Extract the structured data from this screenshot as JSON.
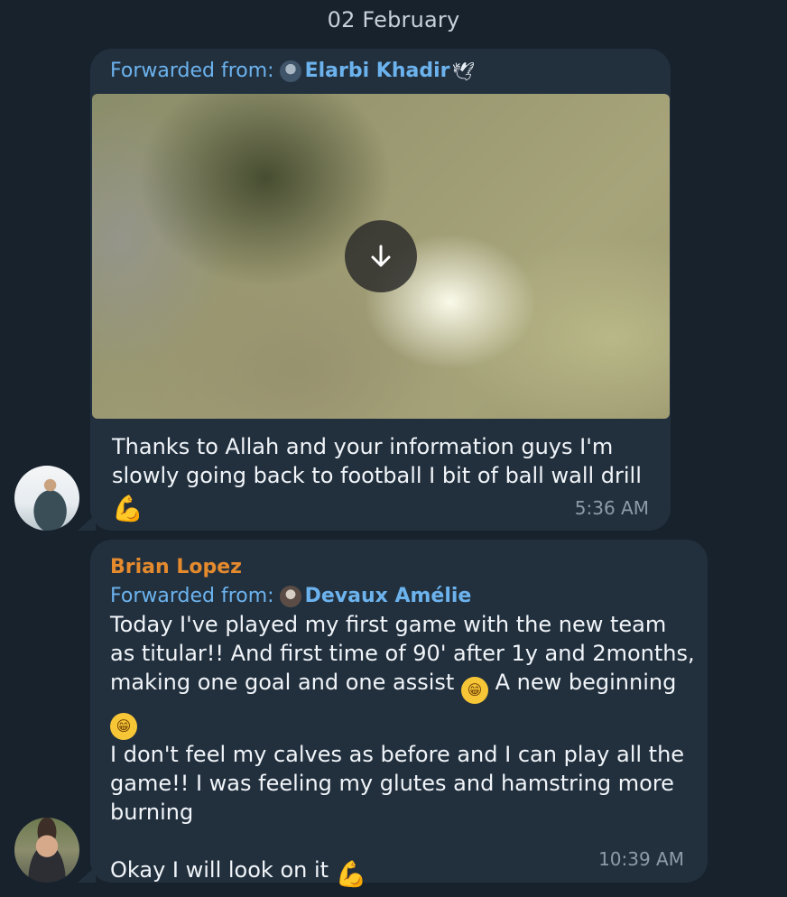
{
  "date_separator": "02 February",
  "messages": [
    {
      "forwarded_label": "Forwarded from:",
      "forwarded_name": "Elarbi Khadir",
      "forwarded_suffix_icon": "dove-icon",
      "media_action_icon": "download-icon",
      "text_parts": [
        "Thanks to Allah and your information guys I'm slowly going back to football I bit of ball wall drill"
      ],
      "emoji_end": "flexed-biceps-dark-icon",
      "time": "5:36 AM"
    },
    {
      "sender": "Brian Lopez",
      "forwarded_label": "Forwarded from:",
      "forwarded_name": "Devaux Amélie",
      "text_line1": "Today I've played my first game with the new team as titular!! And first time of 90' after 1y and 2months, making one goal and one assist",
      "text_line2": " A new beginning",
      "text_line3": "I don't feel my calves as before and I can play all the game!! I was feeling my glutes and hamstring more burning",
      "text_line4": "Okay I will look on it",
      "emoji_1": "grinning-icon",
      "emoji_2": "grinning-icon",
      "emoji_end": "flexed-biceps-light-icon",
      "time": "10:39 AM"
    }
  ],
  "colors": {
    "background": "#18222d",
    "bubble": "#22303e",
    "link": "#6cb3ee",
    "sender": "#e58a2d",
    "text": "#f1f5f9",
    "time": "#8d9aa8"
  }
}
